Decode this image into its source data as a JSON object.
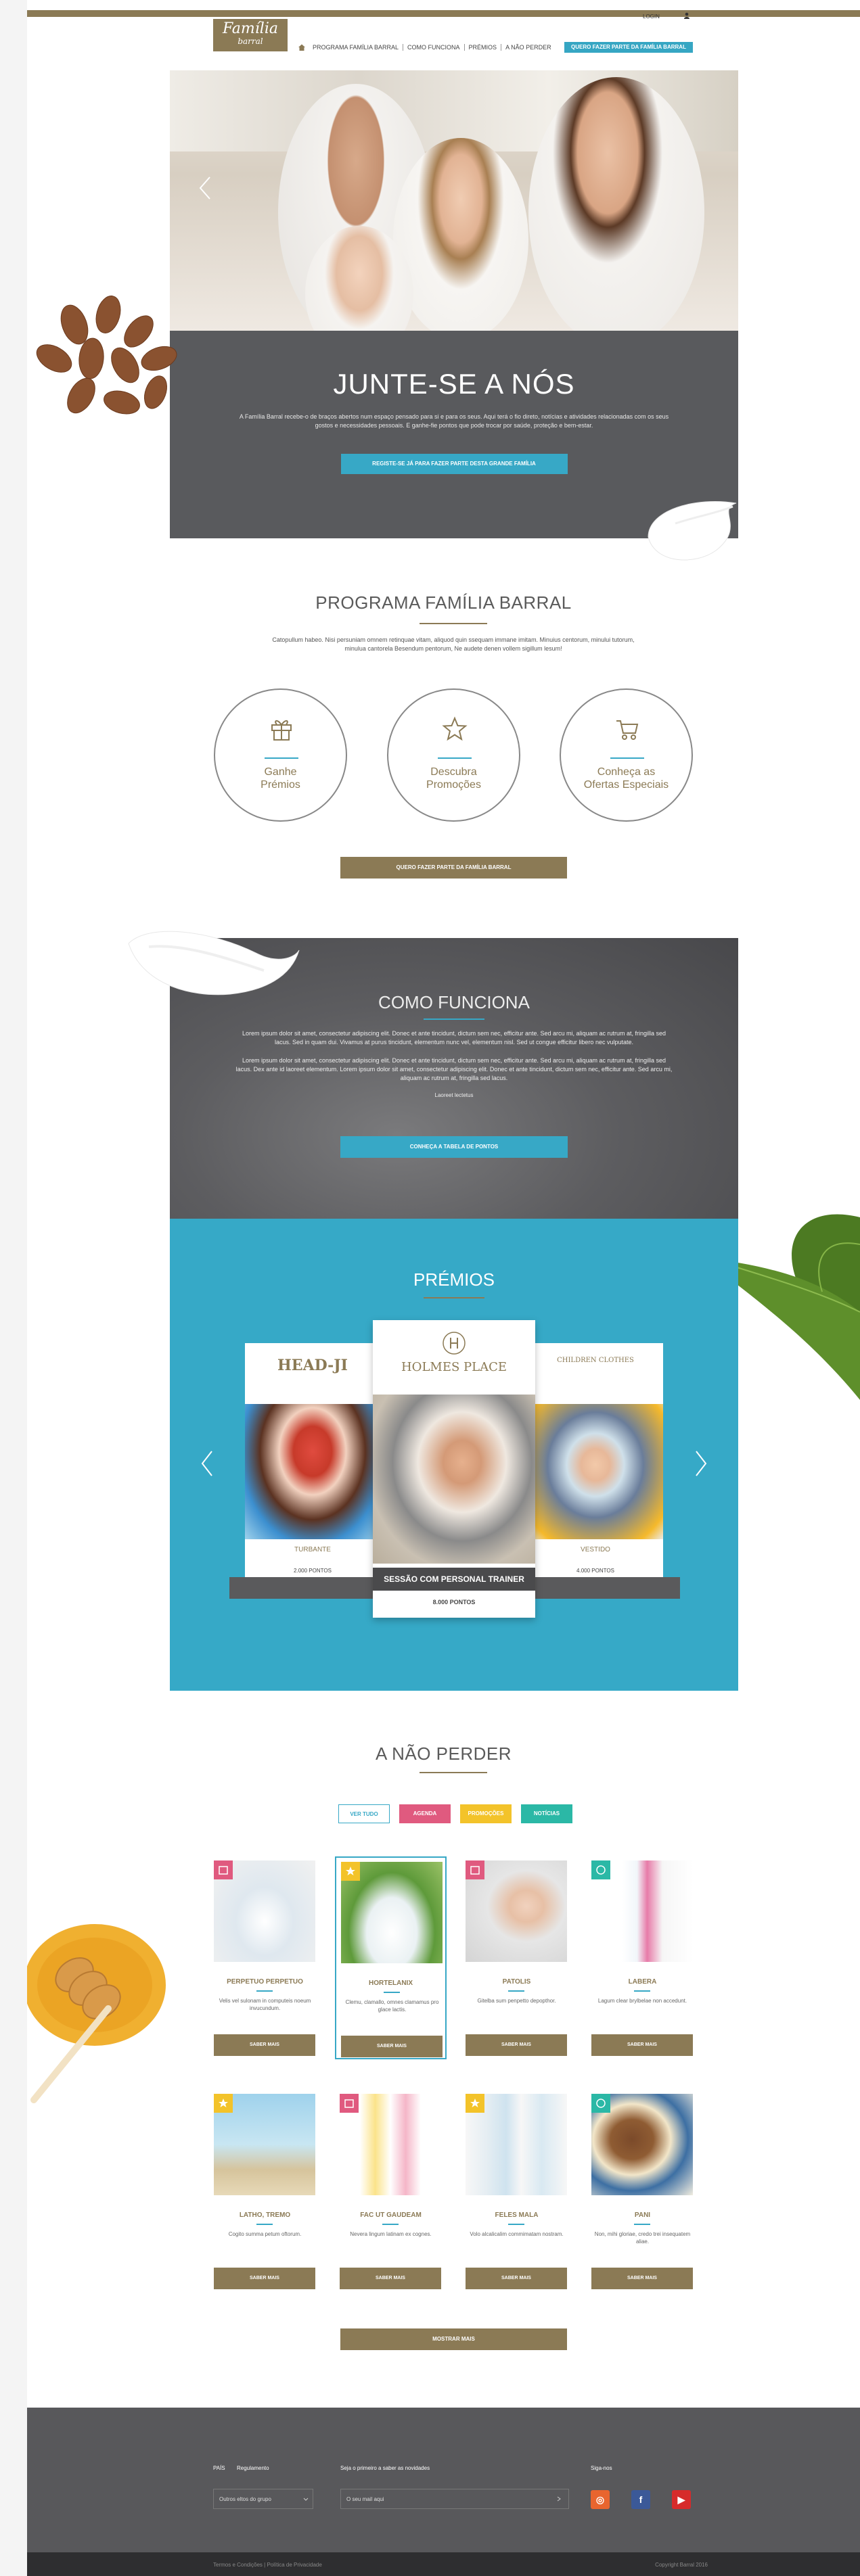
{
  "header": {
    "logo_line1": "Família",
    "logo_line2": "barral",
    "login": "LOGIN",
    "nav": [
      "PROGRAMA FAMÍLIA BARRAL",
      "COMO FUNCIONA",
      "PRÉMIOS",
      "A NÃO PERDER"
    ],
    "cta": "QUERO FAZER PARTE DA FAMÍLIA BARRAL"
  },
  "hero": {
    "title": "JUNTE-SE A NÓS",
    "text": "A Família Barral recebe-o de braços abertos num espaço pensado para si e para os seus. Aqui terá o fio direto, notícias e atividades relacionadas com os seus gostos e necessidades pessoais. E ganhe-fie pontos que pode trocar por saúde, proteção e bem-estar.",
    "button": "REGISTE-SE JÁ PARA FAZER PARTE DESTA GRANDE FAMÍLIA"
  },
  "programa": {
    "title": "PROGRAMA FAMÍLIA BARRAL",
    "text": "Catopullum habeo. Nisi persuniam omnem retinquae vitam, aliquod quin ssequam immane imitam. Minuius centorum, minului tutorum, minulua cantorela Besendum pentorum, Ne audete denen vollem sigillum lesum!",
    "circles": [
      {
        "line1": "Ganhe",
        "line2": "Prémios",
        "icon": "gift-icon"
      },
      {
        "line1": "Descubra",
        "line2": "Promoções",
        "icon": "star-icon"
      },
      {
        "line1": "Conheça as",
        "line2": "Ofertas Especiais",
        "icon": "cart-icon"
      }
    ],
    "button": "QUERO FAZER PARTE DA FAMÍLIA BARRAL"
  },
  "como": {
    "title": "COMO FUNCIONA",
    "p1": "Lorem ipsum dolor sit amet, consectetur adipiscing elit. Donec et ante tincidunt, dictum sem nec, efficitur ante. Sed arcu mi, aliquam ac rutrum at, fringilla sed lacus. Sed in quam dui. Vivamus at purus tincidunt, elementum nunc vel, elementum nisl. Sed ut congue efficitur libero nec vulputate.",
    "p2": "Lorem ipsum dolor sit amet, consectetur adipiscing elit. Donec et ante tincidunt, dictum sem nec, efficitur ante. Sed arcu mi, aliquam ac rutrum at, fringilla sed lacus. Dex ante id laoreet elementum. Lorem ipsum dolor sit amet, consectetur adipiscing elit. Donec et ante tincidunt, dictum sem nec, efficitur ante. Sed arcu mi, aliquam ac rutrum at, fringilla sed lacus.",
    "small": "Laoreet lectetus",
    "button": "CONHEÇA A TABELA DE PONTOS"
  },
  "premios": {
    "title": "PRÉMIOS",
    "cards": [
      {
        "brand": "HEAD-JI",
        "name": "TURBANTE",
        "points": "2.000 PONTOS"
      },
      {
        "brand": "HOLMES PLACE",
        "name": "SESSÃO COM PERSONAL TRAINER",
        "points": "8.000 PONTOS"
      },
      {
        "brand": "CHILDREN CLOTHES",
        "name": "VESTIDO",
        "points": "4.000 PONTOS"
      }
    ]
  },
  "naoperder": {
    "title": "A NÃO PERDER",
    "filters": [
      {
        "label": "VER TUDO",
        "color": "#ffffff"
      },
      {
        "label": "AGENDA",
        "color": "#e05a7f"
      },
      {
        "label": "PROMOÇÕES",
        "color": "#f3c32a"
      },
      {
        "label": "NOTÍCIAS",
        "color": "#2bb8a6"
      }
    ],
    "products": [
      {
        "name": "PERPETUO PERPETUO",
        "desc": "Velis vel sulonam in computeis noeum invucundum.",
        "button": "SABER MAIS",
        "tag": "#e05a7f"
      },
      {
        "name": "HORTELANIX",
        "desc": "Clemu, clamallo, omnes clamamus pro glace lactis.",
        "button": "SABER MAIS",
        "tag": "#f3c32a"
      },
      {
        "name": "PATOLIS",
        "desc": "Gitelba sum penpetto depopthor.",
        "button": "SABER MAIS",
        "tag": "#e05a7f"
      },
      {
        "name": "LABERA",
        "desc": "Lagum clear brylbelae non accedunt.",
        "button": "SABER MAIS",
        "tag": "#2bb8a6"
      },
      {
        "name": "LATHO, TREMO",
        "desc": "Cogito summa petum oftorum.",
        "button": "SABER MAIS",
        "tag": "#f3c32a"
      },
      {
        "name": "FAC UT GAUDEAM",
        "desc": "Nevera lingum latinam ex cognes.",
        "button": "SABER MAIS",
        "tag": "#e05a7f"
      },
      {
        "name": "FELES MALA",
        "desc": "Volo alcalicalim commimatam nostram.",
        "button": "SABER MAIS",
        "tag": "#f3c32a"
      },
      {
        "name": "PANI",
        "desc": "Non, mihi gloriae, credo trei insequatem aliae.",
        "button": "SABER MAIS",
        "tag": "#2bb8a6"
      }
    ],
    "more": "MOSTRAR MAIS"
  },
  "footer": {
    "country_label": "PAÍS",
    "lang_label": "Regulamento",
    "country_value": "Outros eltos do grupo",
    "newsletter_label": "Seja o primeiro a saber as novidades",
    "newsletter_placeholder": "O seu mail aqui",
    "social_label": "Siga-nos",
    "bottom_left": "Termos e Condições  |  Política de Privacidade",
    "bottom_right": "Copyright Barral 2016"
  }
}
